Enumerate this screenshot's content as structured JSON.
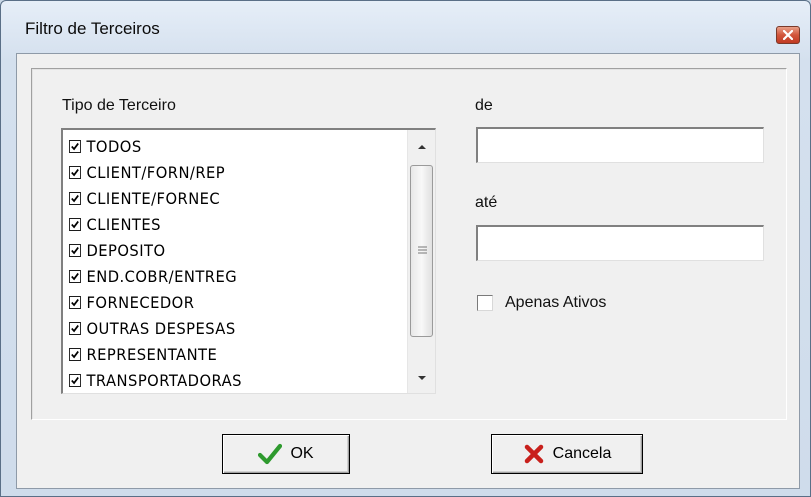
{
  "window": {
    "title": "Filtro de Terceiros"
  },
  "list_section": {
    "label": "Tipo de Terceiro",
    "items": [
      {
        "label": "TODOS",
        "checked": true
      },
      {
        "label": "CLIENT/FORN/REP",
        "checked": true
      },
      {
        "label": "CLIENTE/FORNEC",
        "checked": true
      },
      {
        "label": "CLIENTES",
        "checked": true
      },
      {
        "label": "DEPOSITO",
        "checked": true
      },
      {
        "label": "END.COBR/ENTREG",
        "checked": true
      },
      {
        "label": "FORNECEDOR",
        "checked": true
      },
      {
        "label": "OUTRAS DESPESAS",
        "checked": true
      },
      {
        "label": "REPRESENTANTE",
        "checked": true
      },
      {
        "label": "TRANSPORTADORAS",
        "checked": true
      }
    ]
  },
  "range": {
    "from_label": "de",
    "from_value": "",
    "to_label": "até",
    "to_value": ""
  },
  "options": {
    "only_active_label": "Apenas Ativos",
    "only_active_checked": false
  },
  "buttons": {
    "ok_label": "OK",
    "cancel_label": "Cancela"
  },
  "icons": {
    "close": "close-icon",
    "ok": "checkmark-icon",
    "cancel": "x-mark-icon",
    "scroll_up": "chevron-up-icon",
    "scroll_down": "chevron-down-icon"
  },
  "colors": {
    "ok_icon": "#2e9a2e",
    "cancel_icon": "#c8201c",
    "close_button": "#d2563c"
  }
}
